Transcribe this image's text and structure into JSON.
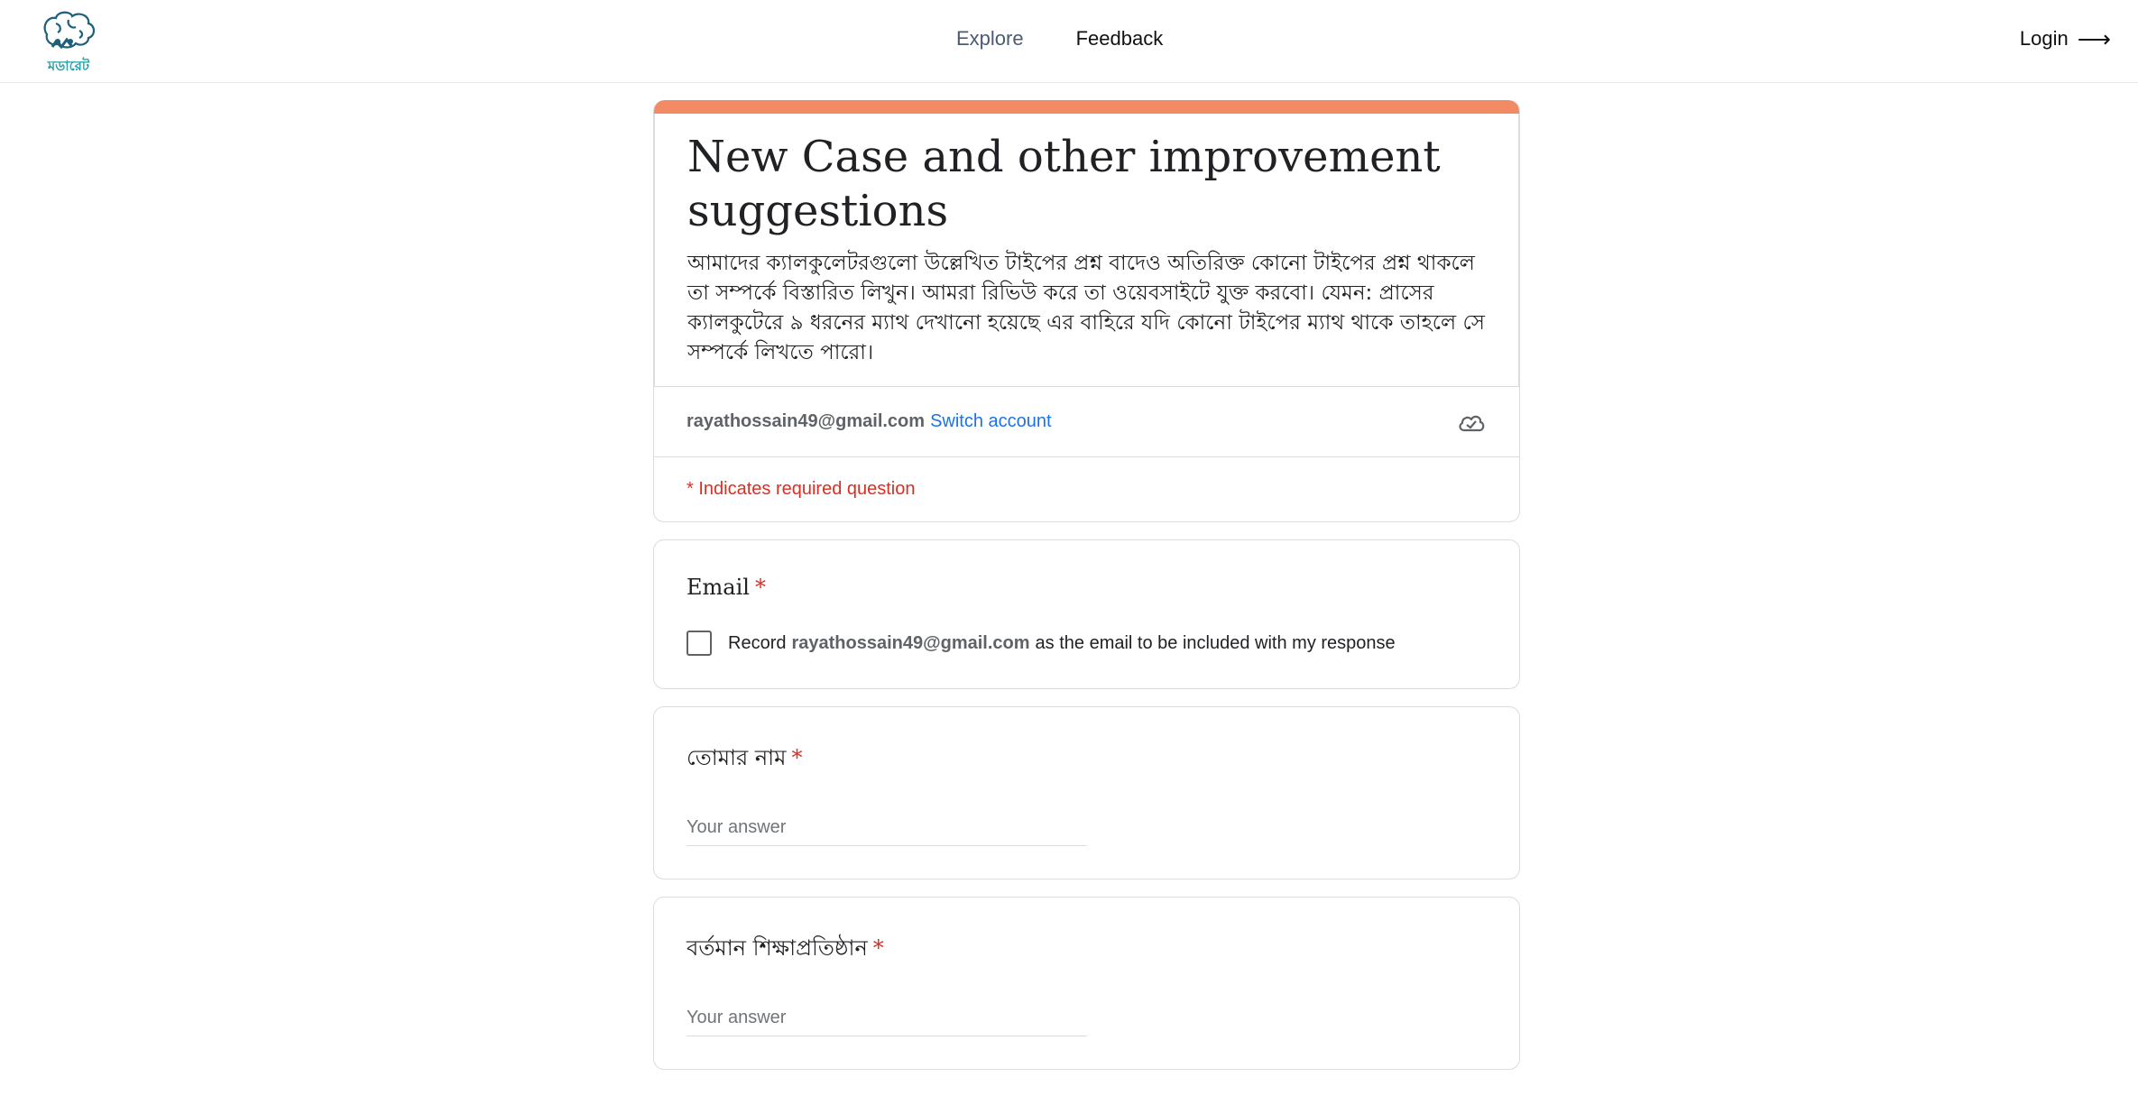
{
  "nav": {
    "logo_alt": "মডারেট",
    "explore": "Explore",
    "feedback": "Feedback",
    "login": "Login",
    "login_arrow": "⟶"
  },
  "colors": {
    "accent": "#f28b63",
    "link": "#1a73e8",
    "required": "#d93025"
  },
  "form": {
    "title": "New Case and other improvement suggestions",
    "description": "আমাদের ক্যালকুলেটরগুলো উল্লেখিত টাইপের প্রশ্ন বাদেও অতিরিক্ত কোনো টাইপের প্রশ্ন থাকলে তা সম্পর্কে বিস্তারিত লিখুন। আমরা রিভিউ করে তা ওয়েবসাইটে যুক্ত করবো। যেমন: প্রাসের ক্যালকুটেরে ৯ ধরনের ম্যাথ দেখানো হয়েছে এর বাহিরে যদি কোনো টাইপের ম্যাথ থাকে তাহলে সে সম্পর্কে লিখতে পারো।",
    "account_email": "rayathossain49@gmail.com",
    "switch_account": "Switch account",
    "cloud_icon": "cloud-check-icon",
    "required_note": "* Indicates required question"
  },
  "questions": {
    "email": {
      "title": "Email",
      "star": "*",
      "record_prefix": "Record",
      "record_email": "rayathossain49@gmail.com",
      "record_suffix": "as the email to be included with my response"
    },
    "name": {
      "title": "তোমার নাম",
      "star": "*",
      "placeholder": "Your answer"
    },
    "institution": {
      "title": "বর্তমান শিক্ষাপ্রতিষ্ঠান",
      "star": "*",
      "placeholder": "Your answer"
    }
  }
}
